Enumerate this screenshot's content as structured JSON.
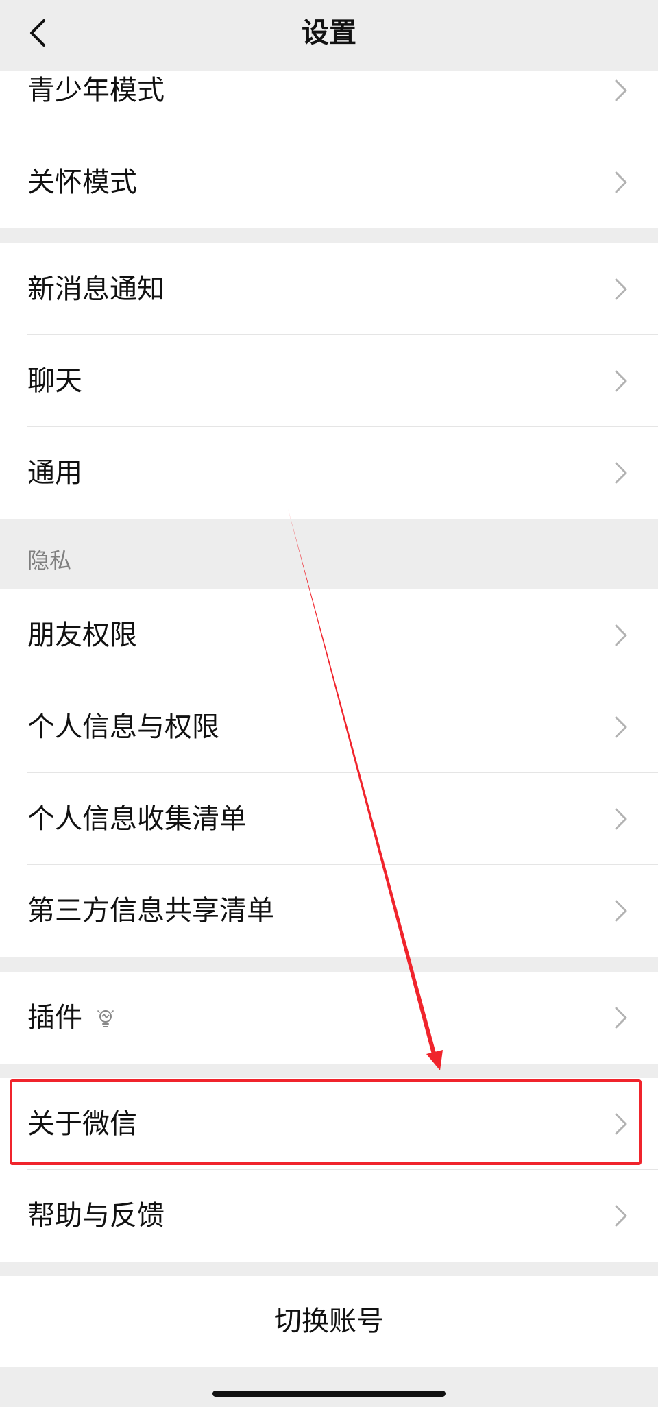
{
  "header": {
    "title": "设置",
    "back_icon": "chevron-left-icon"
  },
  "groups": {
    "mode": [
      "青少年模式",
      "关怀模式"
    ],
    "general": [
      "新消息通知",
      "聊天",
      "通用"
    ],
    "privacy": {
      "title": "隐私",
      "items": [
        "朋友权限",
        "个人信息与权限",
        "个人信息收集清单",
        "第三方信息共享清单"
      ]
    },
    "plugins": [
      "插件"
    ],
    "about": [
      "关于微信",
      "帮助与反馈"
    ]
  },
  "switch_account": "切换账号",
  "annotation": {
    "highlight_color": "#f0242c",
    "highlighted_item": "关于微信"
  },
  "icons": {
    "row_chevron": "chevron-right-icon",
    "plugin_icon": "lightbulb-icon"
  }
}
